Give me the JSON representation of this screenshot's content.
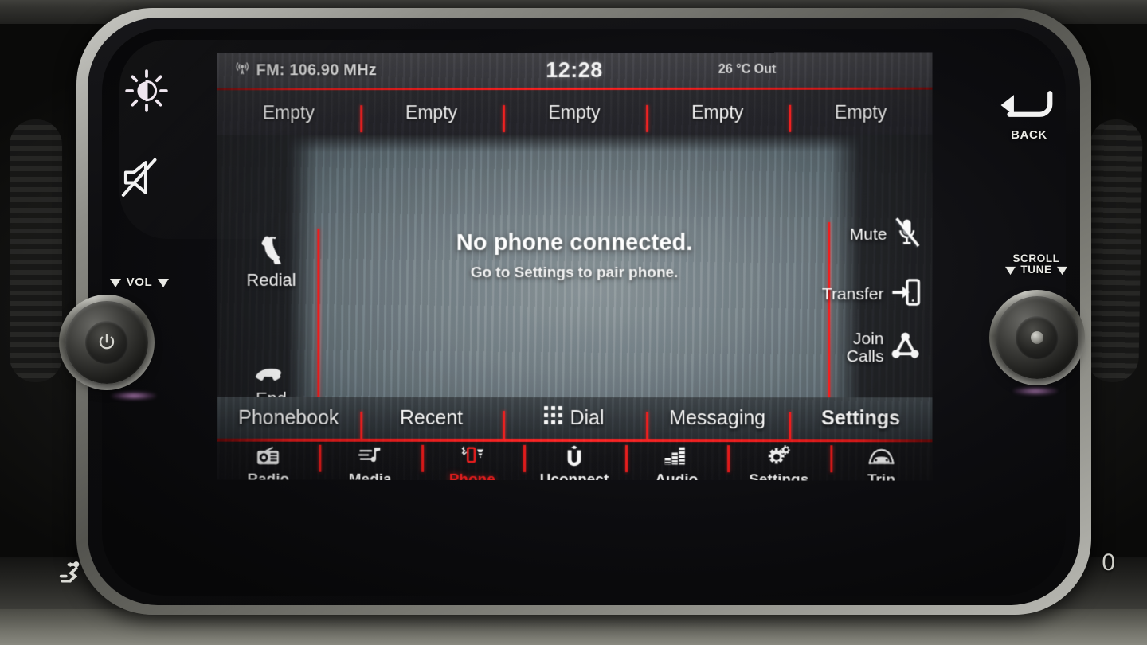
{
  "device": {
    "name": "Uconnect infotainment head unit",
    "accent_red": "#f01f1f",
    "screen_bg": "#0a0a0c"
  },
  "status_bar": {
    "source_icon": "radio-tower-icon",
    "source_label": "FM: 106.90 MHz",
    "clock": "12:28",
    "temperature": "26 °C Out"
  },
  "presets": [
    {
      "label": "Empty"
    },
    {
      "label": "Empty"
    },
    {
      "label": "Empty"
    },
    {
      "label": "Empty"
    },
    {
      "label": "Empty"
    }
  ],
  "message": {
    "title": "No phone connected.",
    "subtitle": "Go to Settings to pair phone."
  },
  "left_controls": [
    {
      "label": "Redial",
      "icon": "phone-handset-icon"
    },
    {
      "label": "End",
      "icon": "end-call-icon"
    }
  ],
  "right_controls": [
    {
      "label": "Mute",
      "icon": "microphone-muted-icon"
    },
    {
      "label": "Transfer",
      "icon": "transfer-phone-icon"
    },
    {
      "label": "Join\nCalls",
      "line1": "Join",
      "line2": "Calls",
      "icon": "join-calls-icon"
    }
  ],
  "function_row": [
    {
      "label": "Phonebook",
      "icon": null,
      "bold": false
    },
    {
      "label": "Recent",
      "icon": null,
      "bold": false
    },
    {
      "label": "Dial",
      "icon": "keypad-grid-icon",
      "bold": false
    },
    {
      "label": "Messaging",
      "icon": null,
      "bold": false
    },
    {
      "label": "Settings",
      "icon": null,
      "bold": true
    }
  ],
  "nav_bar": [
    {
      "label": "Radio",
      "icon": "radio-icon",
      "active": false
    },
    {
      "label": "Media",
      "icon": "music-note-icon",
      "active": false
    },
    {
      "label": "Phone",
      "icon": "phone-bluetooth-icon",
      "active": true
    },
    {
      "label": "Uconnect",
      "icon": "uconnect-logo-icon",
      "active": false
    },
    {
      "label": "Audio",
      "icon": "equalizer-icon",
      "active": false
    },
    {
      "label": "Settings",
      "icon": "gears-icon",
      "active": false
    },
    {
      "label": "Trip",
      "icon": "car-icon",
      "active": false
    }
  ],
  "hardware": {
    "brightness_button": {
      "label": "",
      "icon": "brightness-sun-icon"
    },
    "mute_button": {
      "label": "",
      "icon": "speaker-muted-icon"
    },
    "back_button": {
      "label": "BACK",
      "icon": "back-arrow-icon"
    },
    "volume_knob": {
      "label": "VOL",
      "icon": "volume-knob"
    },
    "tune_knob": {
      "label_line1": "SCROLL",
      "label_line2": "TUNE",
      "icon": "scroll-tune-knob"
    },
    "vent_control": {
      "icon": "airflow-icon"
    },
    "zero_marking": {
      "label": "0"
    }
  }
}
